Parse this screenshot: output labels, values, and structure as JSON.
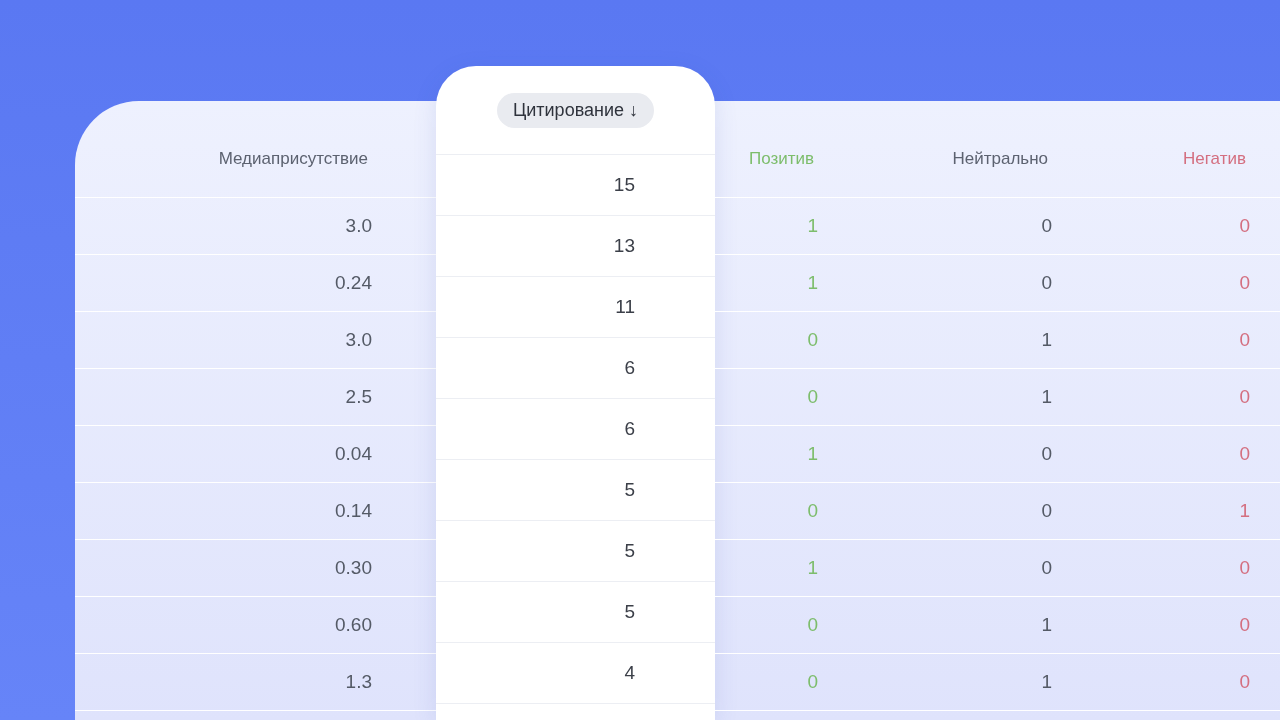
{
  "table": {
    "columns": [
      {
        "label": "Медиаприсутствие",
        "kind": "plain",
        "selected": false
      },
      {
        "label": "Цитирование ↓",
        "kind": "plain",
        "selected": true
      },
      {
        "label": "Позитив",
        "kind": "positive",
        "selected": false
      },
      {
        "label": "Нейтрально",
        "kind": "plain",
        "selected": false
      },
      {
        "label": "Негатив",
        "kind": "negative",
        "selected": false
      }
    ],
    "rows": [
      [
        "3.0",
        "15",
        "1",
        "0",
        "0"
      ],
      [
        "0.24",
        "13",
        "1",
        "0",
        "0"
      ],
      [
        "3.0",
        "11",
        "0",
        "1",
        "0"
      ],
      [
        "2.5",
        "6",
        "0",
        "1",
        "0"
      ],
      [
        "0.04",
        "6",
        "1",
        "0",
        "0"
      ],
      [
        "0.14",
        "5",
        "0",
        "0",
        "1"
      ],
      [
        "0.30",
        "5",
        "1",
        "0",
        "0"
      ],
      [
        "0.60",
        "5",
        "0",
        "1",
        "0"
      ],
      [
        "1.3",
        "4",
        "0",
        "1",
        "0"
      ]
    ]
  }
}
